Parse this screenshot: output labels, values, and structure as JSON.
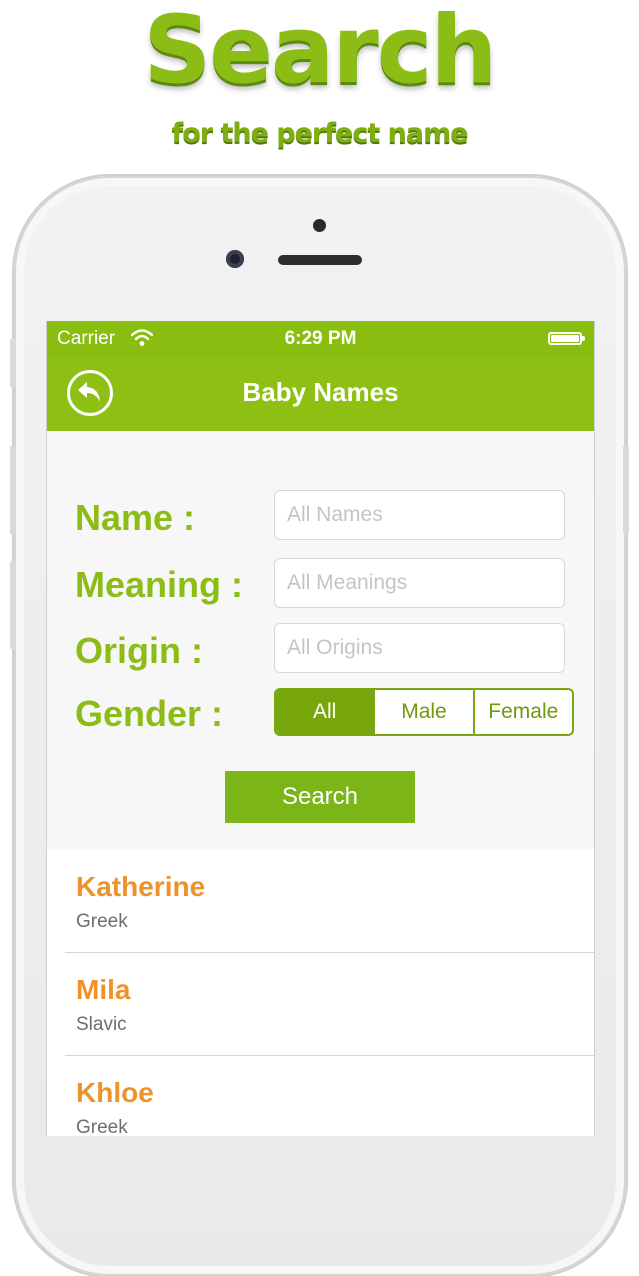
{
  "promo": {
    "title": "Search",
    "subtitle": "for the perfect name"
  },
  "status_bar": {
    "carrier": "Carrier",
    "time": "6:29 PM"
  },
  "navbar": {
    "title": "Baby Names",
    "back_icon": "back-arrow-circle-icon"
  },
  "form": {
    "name_label": "Name :",
    "name_placeholder": "All Names",
    "meaning_label": "Meaning :",
    "meaning_placeholder": "All Meanings",
    "origin_label": "Origin :",
    "origin_placeholder": "All Origins",
    "gender_label": "Gender :",
    "gender_options": [
      "All",
      "Male",
      "Female"
    ],
    "gender_selected": "All",
    "search_label": "Search"
  },
  "results": [
    {
      "name": "Katherine",
      "origin": "Greek"
    },
    {
      "name": "Mila",
      "origin": "Slavic"
    },
    {
      "name": "Khloe",
      "origin": "Greek"
    }
  ],
  "colors": {
    "brand_green": "#8dc012",
    "name_orange": "#f0922a"
  }
}
